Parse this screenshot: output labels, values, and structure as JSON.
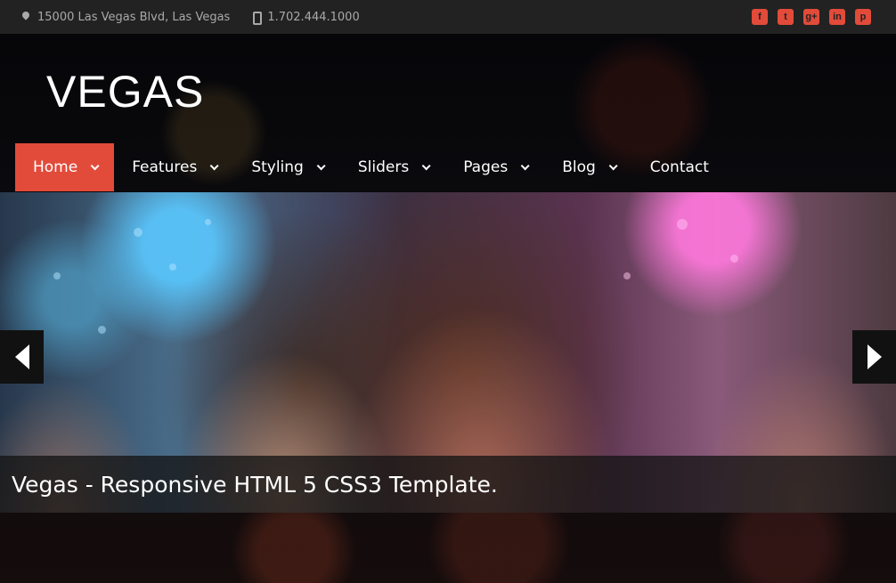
{
  "topbar": {
    "address": "15000 Las Vegas Blvd, Las Vegas",
    "phone": "1.702.444.1000",
    "social": [
      {
        "icon": "facebook-icon",
        "glyph": "f"
      },
      {
        "icon": "twitter-icon",
        "glyph": "t"
      },
      {
        "icon": "google-plus-icon",
        "glyph": "g+"
      },
      {
        "icon": "linkedin-icon",
        "glyph": "in"
      },
      {
        "icon": "pinterest-icon",
        "glyph": "p"
      }
    ]
  },
  "logo": "VEGAS",
  "nav": [
    {
      "label": "Home",
      "dropdown": true,
      "active": true
    },
    {
      "label": "Features",
      "dropdown": true
    },
    {
      "label": "Styling",
      "dropdown": true
    },
    {
      "label": "Sliders",
      "dropdown": true
    },
    {
      "label": "Pages",
      "dropdown": true
    },
    {
      "label": "Blog",
      "dropdown": true
    },
    {
      "label": "Contact",
      "dropdown": false
    }
  ],
  "slider": {
    "caption": "Vegas - Responsive HTML 5 CSS3 Template.",
    "prev_icon": "arrow-left-icon",
    "next_icon": "arrow-right-icon"
  },
  "colors": {
    "accent": "#e24b3a",
    "topbar": "#222222",
    "topbar_text": "#a9a9a9"
  }
}
